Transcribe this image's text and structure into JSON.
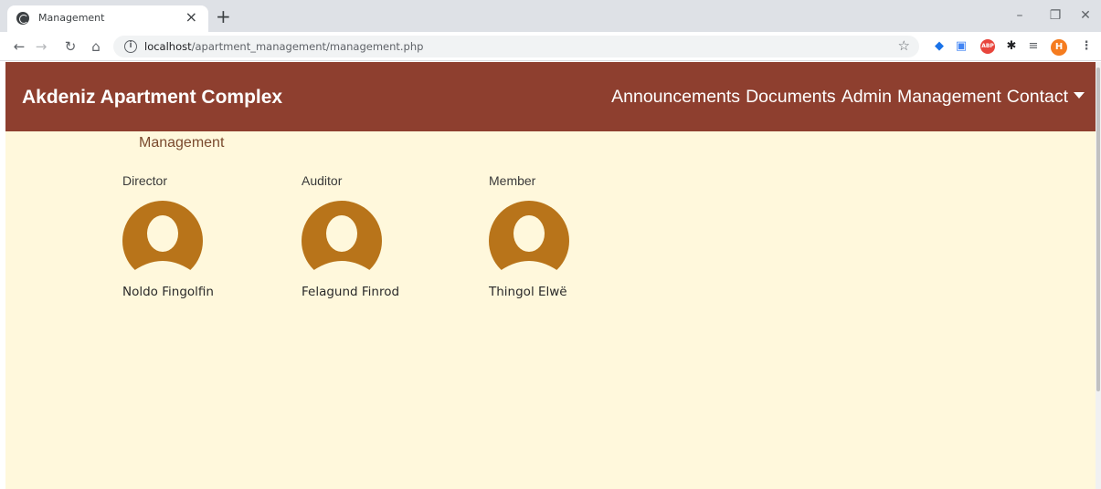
{
  "browser": {
    "tab_title": "Management",
    "url_host": "localhost",
    "url_path": "/apartment_management/management.php",
    "profile_initial": "H",
    "abp_label": "ABP"
  },
  "navbar": {
    "brand": "Akdeniz Apartment Complex",
    "items": [
      {
        "label": "Announcements"
      },
      {
        "label": "Documents"
      },
      {
        "label": "Admin"
      },
      {
        "label": "Management"
      },
      {
        "label": "Contact"
      }
    ]
  },
  "page": {
    "section_title": "Management",
    "members": [
      {
        "role": "Director",
        "name": "Noldo Fingolfin"
      },
      {
        "role": "Auditor",
        "name": "Felagund Finrod"
      },
      {
        "role": "Member",
        "name": "Thingol Elwë"
      }
    ]
  },
  "colors": {
    "navbar_bg": "#8e3f2f",
    "page_bg": "#fff8dc",
    "avatar_fill": "#b8741a",
    "section_title": "#7a4a2e"
  }
}
